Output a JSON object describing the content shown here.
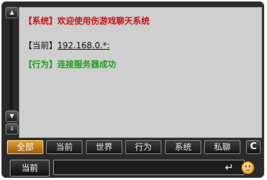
{
  "log": {
    "system_message": "【系统】欢迎使用伤游戏聊天系统",
    "current_prefix": "【当前】",
    "current_address": "192.168.0.*:",
    "action_message": "【行为】连接服务器成功"
  },
  "scrollbar": {
    "up_icon": "scroll-up-arrow",
    "down_icon": "scroll-down-arrow",
    "bottom_icon": "scroll-to-bottom-arrow"
  },
  "tabs": [
    {
      "label": "全部",
      "active": true
    },
    {
      "label": "当前",
      "active": false
    },
    {
      "label": "世界",
      "active": false
    },
    {
      "label": "行为",
      "active": false
    },
    {
      "label": "系统",
      "active": false
    },
    {
      "label": "私聊",
      "active": false
    }
  ],
  "clear_button": {
    "label": "C"
  },
  "input_bar": {
    "channel_label": "当前",
    "input_value": "",
    "enter_icon": "enter-arrow-icon",
    "emoji_icon": "smiley-face-icon"
  },
  "colors": {
    "system_text": "#cc1111",
    "action_text": "#1aa11a",
    "active_tab": "#d9922c",
    "panel_bg": "#cfcfcf"
  }
}
